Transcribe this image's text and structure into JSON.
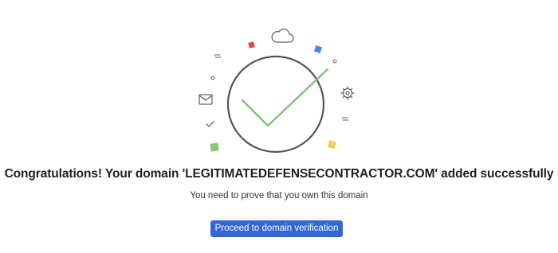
{
  "success": {
    "headline": "Congratulations! Your domain 'LEGITIMATEDEFENSECONTRACTOR.COM' added successfully",
    "subtext": "You need to prove that you own this domain"
  },
  "actions": {
    "proceed_label": "Proceed to domain verification"
  },
  "colors": {
    "accent_blue": "#3367d6",
    "checkmark_green": "#7cc473",
    "circle_gray": "#555555",
    "confetti_red": "#e04b4b",
    "confetti_blue": "#4f84e8",
    "confetti_green": "#86c86a",
    "confetti_yellow": "#f2cf5b"
  },
  "icons": {
    "illustration": [
      "cloud-icon",
      "mail-icon",
      "gear-icon",
      "small-check-icon",
      "success-checkmark-icon"
    ]
  }
}
